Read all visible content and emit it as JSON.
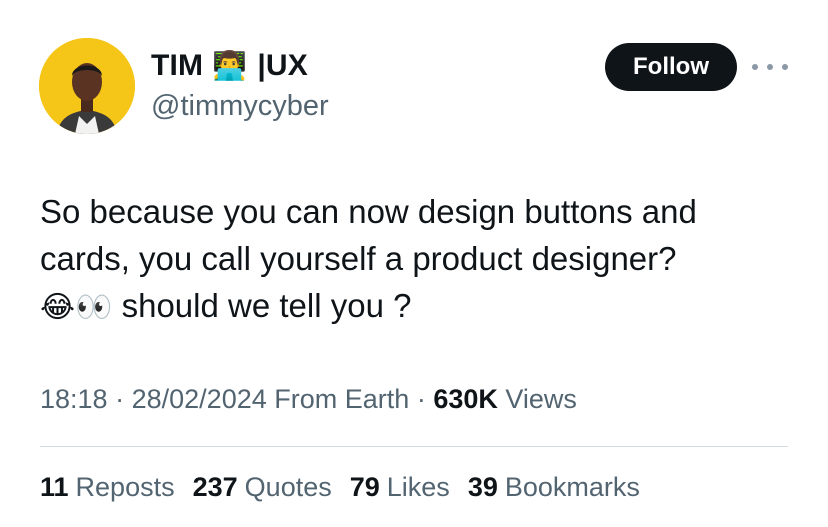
{
  "author": {
    "display_name": "TIM",
    "display_name_emoji": "👨‍💻",
    "display_name_suffix": "|UX",
    "handle": "@timmycyber",
    "avatar_bg": "#f5c518"
  },
  "follow_button": {
    "label": "Follow"
  },
  "more_menu": {
    "icon": "more-horizontal-icon"
  },
  "tweet": {
    "text_line1": "So because you can now design buttons and",
    "text_line2": "cards, you call yourself a product designer?",
    "text_line3_emoji": "😂👀",
    "text_line3": "should we tell you ?"
  },
  "meta": {
    "time": "18:18",
    "separator": "·",
    "date": "28/02/2024",
    "source": "From Earth",
    "views_count": "630K",
    "views_label": "Views"
  },
  "stats": {
    "reposts_count": "11",
    "reposts_label": "Reposts",
    "quotes_count": "237",
    "quotes_label": "Quotes",
    "likes_count": "79",
    "likes_label": "Likes",
    "bookmarks_count": "39",
    "bookmarks_label": "Bookmarks"
  }
}
